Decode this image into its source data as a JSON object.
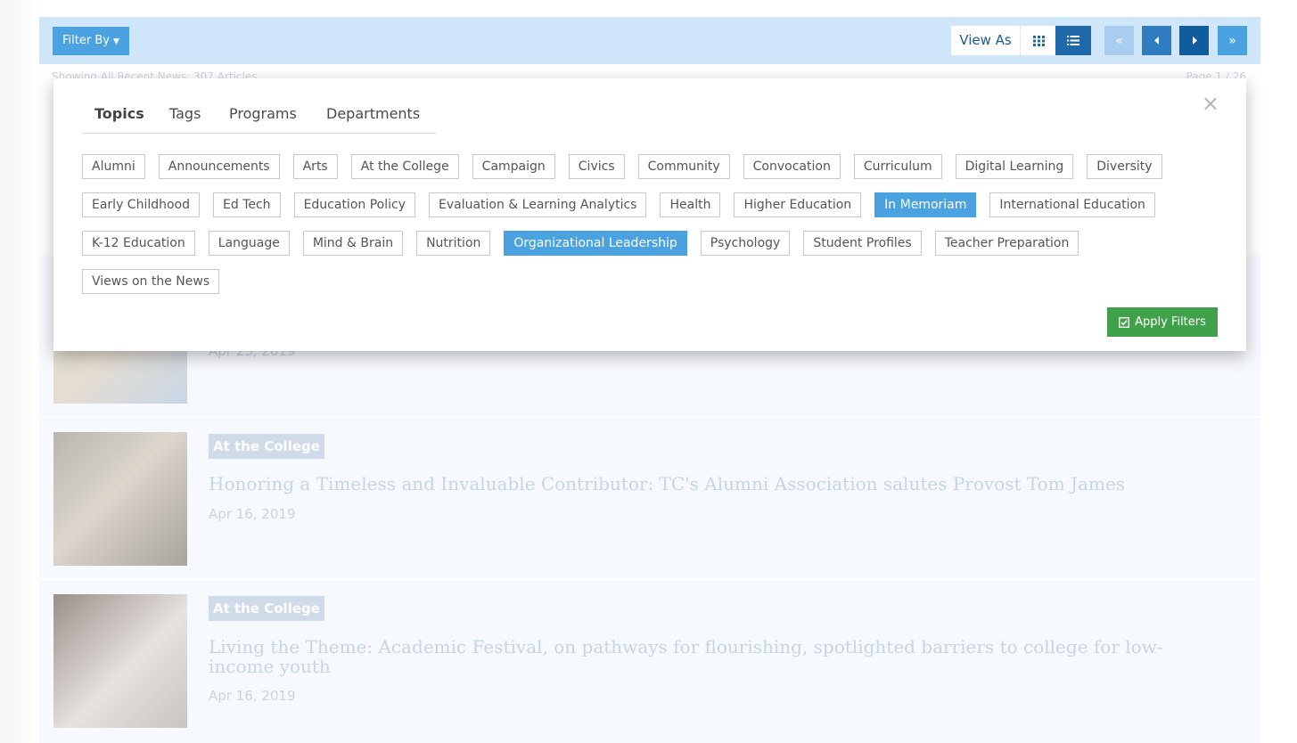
{
  "toolbar": {
    "filter_label": "Filter By",
    "view_as_label": "View As",
    "grid_icon": "grid-icon",
    "list_icon": "list-icon",
    "pagination": {
      "first": "«",
      "prev": "‹",
      "next": "›",
      "last": "»"
    }
  },
  "status": {
    "text": "Showing All Recent News: 307 Articles",
    "page_info": "Page 1 / 26"
  },
  "filter_panel": {
    "close_label": "×",
    "tabs": [
      "Topics",
      "Tags",
      "Programs",
      "Departments"
    ],
    "active_tab": "Topics",
    "chips": [
      [
        "Alumni",
        "Announcements",
        "Arts",
        "At the College",
        "Campaign",
        "Civics",
        "Community",
        "Convocation",
        "Curriculum",
        "Digital Learning",
        "Diversity"
      ],
      [
        "Early Childhood",
        "Ed Tech",
        "Education Policy",
        "Evaluation & Learning Analytics",
        "Health",
        "Higher Education",
        "In Memoriam",
        "International Education"
      ],
      [
        "K-12 Education",
        "Language",
        "Mind & Brain",
        "Nutrition",
        "Organizational Leadership",
        "Psychology",
        "Student Profiles",
        "Teacher Preparation"
      ],
      [
        "Views on the News"
      ]
    ],
    "selected": [
      "In Memoriam",
      "Organizational Leadership"
    ],
    "apply_label": "Apply Filters"
  },
  "articles": [
    {
      "category": "",
      "title": "",
      "date": "Apr 25, 2019"
    },
    {
      "category": "At the College",
      "title": "Honoring a Timeless and Invaluable Contributor: TC's Alumni Association salutes Provost Tom James",
      "date": "Apr 16, 2019"
    },
    {
      "category": "At the College",
      "title": "Living the Theme: Academic Festival, on pathways for flourishing, spotlighted barriers to college for low-income youth",
      "date": "Apr 16, 2019"
    }
  ],
  "colors": {
    "accent": "#4aa3e0",
    "apply": "#3fa24a",
    "toolbar_bg": "#cfe6fb"
  }
}
